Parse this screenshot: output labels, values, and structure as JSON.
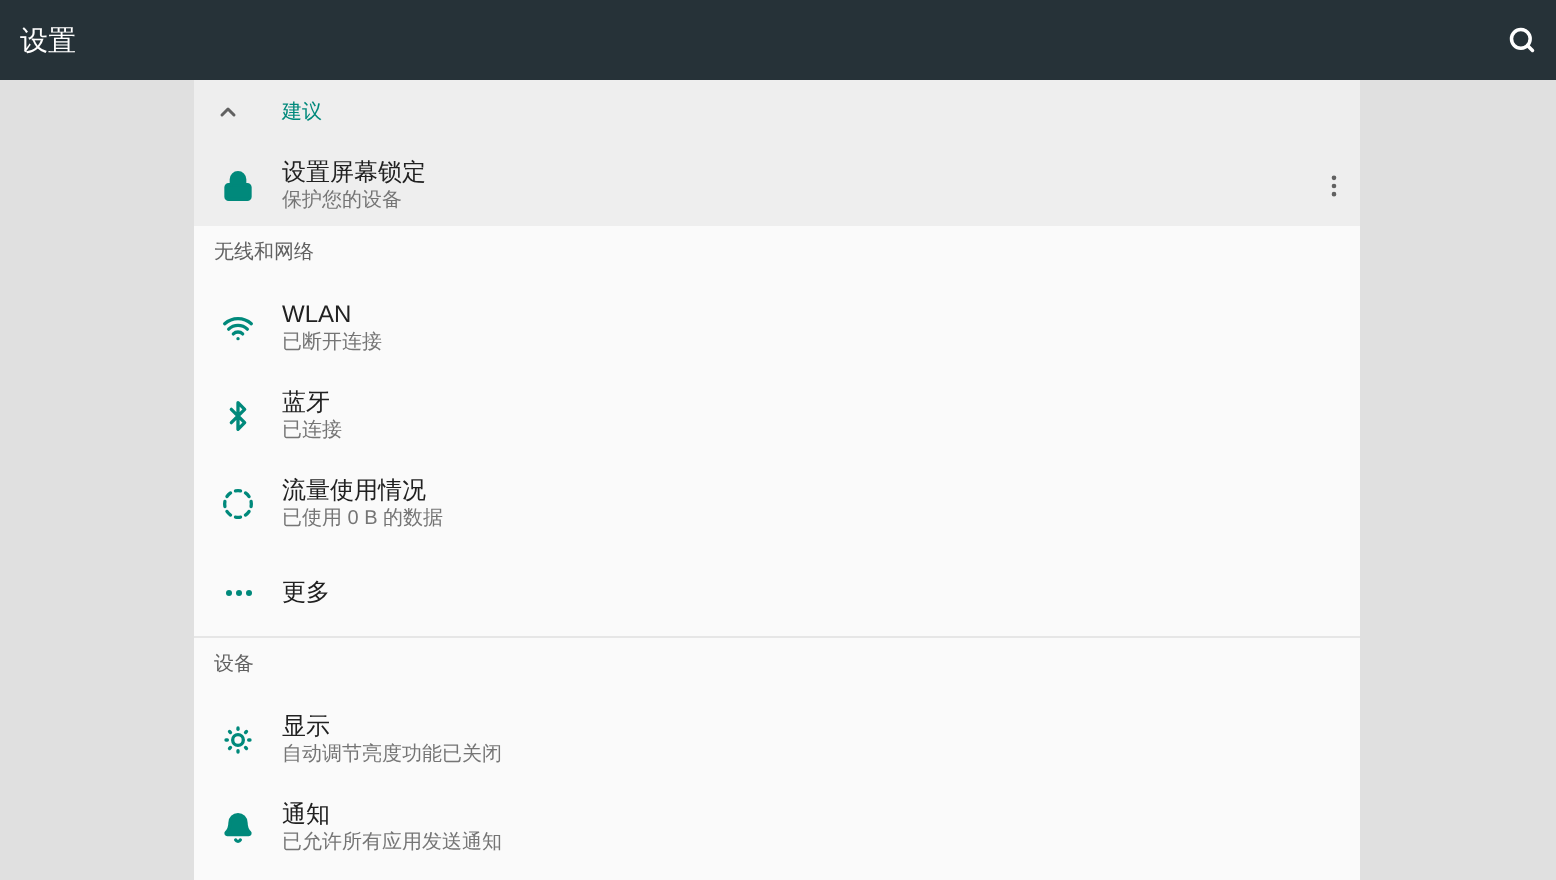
{
  "app_bar": {
    "title": "设置"
  },
  "suggestions": {
    "header": "建议",
    "expanded": true,
    "items": [
      {
        "kind": "lock",
        "title": "设置屏幕锁定",
        "summary": "保护您的设备"
      }
    ]
  },
  "sections": [
    {
      "header": "无线和网络",
      "items": [
        {
          "kind": "wifi",
          "title": "WLAN",
          "summary": "已断开连接"
        },
        {
          "kind": "bluetooth",
          "title": "蓝牙",
          "summary": "已连接"
        },
        {
          "kind": "data",
          "title": "流量使用情况",
          "summary": "已使用 0 B 的数据"
        },
        {
          "kind": "more",
          "title": "更多"
        }
      ]
    },
    {
      "header": "设备",
      "items": [
        {
          "kind": "brightness",
          "title": "显示",
          "summary": "自动调节亮度功能已关闭"
        },
        {
          "kind": "bell",
          "title": "通知",
          "summary": "已允许所有应用发送通知"
        }
      ]
    }
  ]
}
